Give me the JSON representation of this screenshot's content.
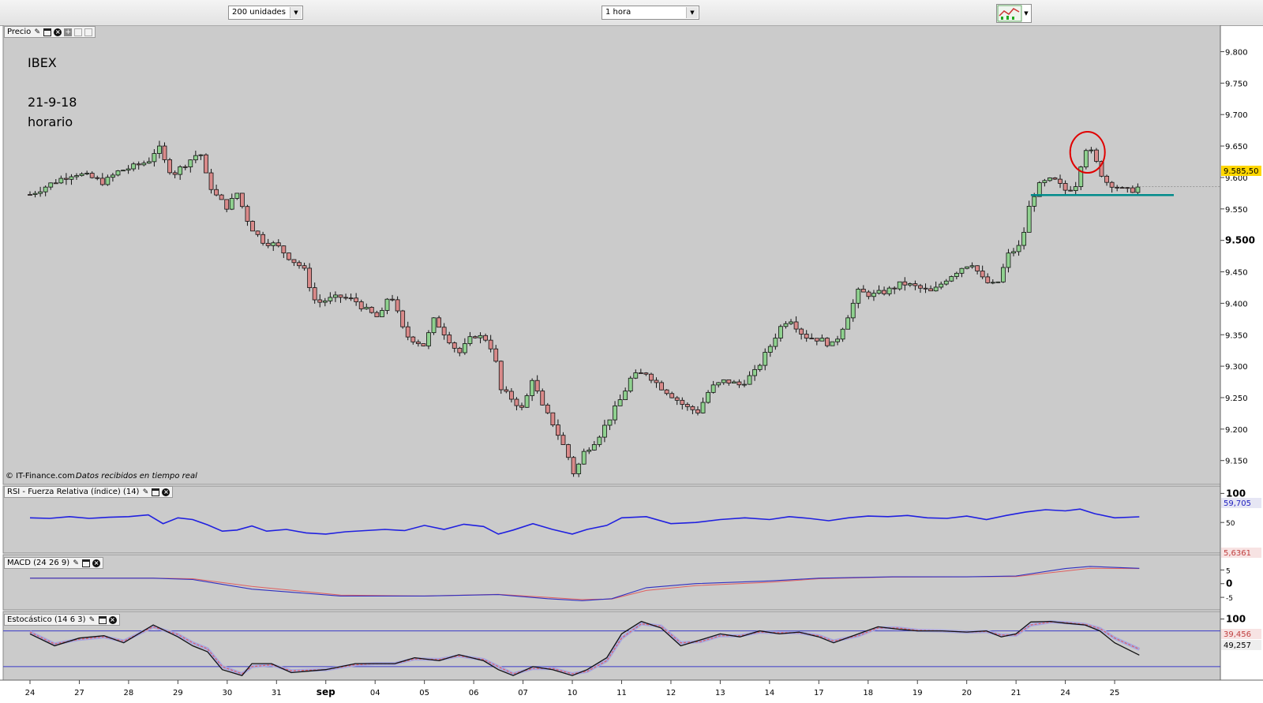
{
  "toolbar": {
    "units_select": "200 unidades",
    "interval_select": "1 hora",
    "chart_type_icon": "candlestick-chart-icon"
  },
  "panes": {
    "price_title": "Precio",
    "rsi_title": "RSI - Fuerza Relativa (índice) (14)",
    "macd_title": "MACD (24 26 9)",
    "stoch_title": "Estocástico (14 6 3)"
  },
  "annotations": {
    "symbol": "IBEX",
    "date": "21-9-18",
    "timeframe": "horario",
    "credit": "© IT-Finance.com",
    "credit_note": "Datos recibidos en tiempo real",
    "last_price": "9.585,50",
    "rsi_value": "59,705",
    "macd_value": "5,6361",
    "stoch_k_value": "49,257",
    "stoch_d_value": "39,456"
  },
  "colors": {
    "up": "#8fd18f",
    "down": "#d98a8a",
    "rsi_line": "#2020e0",
    "macd_line": "#3030c0",
    "signal_line": "#e06060",
    "support_line": "#008b8b",
    "highlight_circle": "#e00000",
    "plot_bg": "#cbcbcb"
  },
  "chart_data": {
    "type": "candlestick",
    "title": "IBEX",
    "xlabel": "",
    "ylabel": "",
    "x_tick_labels": [
      "24",
      "27",
      "28",
      "29",
      "30",
      "31",
      "sep",
      "04",
      "05",
      "06",
      "07",
      "10",
      "11",
      "12",
      "13",
      "14",
      "17",
      "18",
      "19",
      "20",
      "21",
      "24",
      "25"
    ],
    "y_tick_labels": [
      "9.800",
      "9.750",
      "9.700",
      "9.650",
      "9.600",
      "9.550",
      "9.500",
      "9.450",
      "9.400",
      "9.350",
      "9.300",
      "9.250",
      "9.200",
      "9.150"
    ],
    "ylim": [
      9112,
      9842
    ],
    "x_range": [
      0,
      23.2
    ],
    "grid": false,
    "price_path": [
      [
        0,
        9573
      ],
      [
        0.3,
        9585
      ],
      [
        0.6,
        9597
      ],
      [
        0.9,
        9607
      ],
      [
        1.2,
        9601
      ],
      [
        1.5,
        9592
      ],
      [
        1.8,
        9610
      ],
      [
        2.1,
        9617
      ],
      [
        2.4,
        9626
      ],
      [
        2.6,
        9650
      ],
      [
        2.75,
        9622
      ],
      [
        2.9,
        9605
      ],
      [
        3.2,
        9625
      ],
      [
        3.45,
        9641
      ],
      [
        3.6,
        9594
      ],
      [
        3.8,
        9568
      ],
      [
        4.0,
        9553
      ],
      [
        4.2,
        9575
      ],
      [
        4.45,
        9525
      ],
      [
        4.7,
        9500
      ],
      [
        5.0,
        9492
      ],
      [
        5.3,
        9470
      ],
      [
        5.55,
        9455
      ],
      [
        5.8,
        9400
      ],
      [
        6.0,
        9405
      ],
      [
        6.3,
        9410
      ],
      [
        6.6,
        9404
      ],
      [
        6.8,
        9390
      ],
      [
        7.1,
        9375
      ],
      [
        7.3,
        9420
      ],
      [
        7.6,
        9350
      ],
      [
        8.0,
        9333
      ],
      [
        8.2,
        9375
      ],
      [
        8.45,
        9348
      ],
      [
        8.7,
        9320
      ],
      [
        9.0,
        9350
      ],
      [
        9.3,
        9342
      ],
      [
        9.45,
        9305
      ],
      [
        9.55,
        9262
      ],
      [
        9.8,
        9247
      ],
      [
        10.0,
        9230
      ],
      [
        10.2,
        9285
      ],
      [
        10.35,
        9240
      ],
      [
        10.6,
        9210
      ],
      [
        10.9,
        9160
      ],
      [
        11.05,
        9125
      ],
      [
        11.2,
        9160
      ],
      [
        11.5,
        9185
      ],
      [
        11.7,
        9210
      ],
      [
        12.0,
        9250
      ],
      [
        12.2,
        9283
      ],
      [
        12.5,
        9290
      ],
      [
        12.75,
        9270
      ],
      [
        13.0,
        9255
      ],
      [
        13.3,
        9235
      ],
      [
        13.55,
        9228
      ],
      [
        13.8,
        9265
      ],
      [
        14.1,
        9277
      ],
      [
        14.4,
        9270
      ],
      [
        14.7,
        9290
      ],
      [
        15.0,
        9330
      ],
      [
        15.2,
        9360
      ],
      [
        15.4,
        9378
      ],
      [
        15.7,
        9348
      ],
      [
        16.0,
        9343
      ],
      [
        16.3,
        9333
      ],
      [
        16.5,
        9365
      ],
      [
        16.8,
        9418
      ],
      [
        17.1,
        9413
      ],
      [
        17.4,
        9420
      ],
      [
        17.7,
        9432
      ],
      [
        18.0,
        9425
      ],
      [
        18.3,
        9417
      ],
      [
        18.6,
        9440
      ],
      [
        18.9,
        9457
      ],
      [
        19.1,
        9465
      ],
      [
        19.35,
        9435
      ],
      [
        19.6,
        9427
      ],
      [
        19.85,
        9478
      ],
      [
        20.1,
        9492
      ],
      [
        20.3,
        9565
      ],
      [
        20.5,
        9590
      ],
      [
        20.75,
        9597
      ],
      [
        21.0,
        9580
      ],
      [
        21.2,
        9586
      ],
      [
        21.4,
        9648
      ],
      [
        21.55,
        9638
      ],
      [
        21.7,
        9610
      ],
      [
        21.85,
        9592
      ],
      [
        22.0,
        9588
      ],
      [
        22.2,
        9578
      ],
      [
        22.35,
        9580
      ],
      [
        22.5,
        9585
      ]
    ],
    "support_line": {
      "from_x": 20.3,
      "to_x": 23.2,
      "value": 9572
    },
    "highlight": {
      "x": 21.45,
      "value": 9640
    },
    "last_price": 9585.5,
    "rsi": {
      "ylim": [
        0,
        110
      ],
      "y_tick_labels": [
        "100",
        "50"
      ],
      "values": [
        [
          0,
          58
        ],
        [
          0.4,
          57
        ],
        [
          0.8,
          60
        ],
        [
          1.2,
          57
        ],
        [
          1.6,
          59
        ],
        [
          2.0,
          60
        ],
        [
          2.4,
          63
        ],
        [
          2.7,
          48
        ],
        [
          3.0,
          58
        ],
        [
          3.3,
          55
        ],
        [
          3.6,
          46
        ],
        [
          3.9,
          35
        ],
        [
          4.2,
          37
        ],
        [
          4.5,
          44
        ],
        [
          4.8,
          35
        ],
        [
          5.2,
          38
        ],
        [
          5.6,
          32
        ],
        [
          6.0,
          30
        ],
        [
          6.4,
          34
        ],
        [
          6.8,
          36
        ],
        [
          7.2,
          38
        ],
        [
          7.6,
          36
        ],
        [
          8.0,
          45
        ],
        [
          8.4,
          38
        ],
        [
          8.8,
          47
        ],
        [
          9.2,
          43
        ],
        [
          9.5,
          30
        ],
        [
          9.8,
          37
        ],
        [
          10.2,
          48
        ],
        [
          10.6,
          38
        ],
        [
          11.0,
          30
        ],
        [
          11.3,
          38
        ],
        [
          11.7,
          45
        ],
        [
          12.0,
          58
        ],
        [
          12.5,
          60
        ],
        [
          13.0,
          48
        ],
        [
          13.5,
          50
        ],
        [
          14.0,
          55
        ],
        [
          14.5,
          58
        ],
        [
          15.0,
          55
        ],
        [
          15.4,
          60
        ],
        [
          15.8,
          57
        ],
        [
          16.2,
          53
        ],
        [
          16.6,
          58
        ],
        [
          17.0,
          61
        ],
        [
          17.4,
          60
        ],
        [
          17.8,
          62
        ],
        [
          18.2,
          58
        ],
        [
          18.6,
          57
        ],
        [
          19.0,
          61
        ],
        [
          19.4,
          55
        ],
        [
          19.8,
          62
        ],
        [
          20.2,
          68
        ],
        [
          20.6,
          72
        ],
        [
          21.0,
          70
        ],
        [
          21.3,
          73
        ],
        [
          21.6,
          65
        ],
        [
          22.0,
          58
        ],
        [
          22.5,
          59.7
        ]
      ],
      "last": 59.705
    },
    "macd": {
      "ylim": [
        -9,
        10
      ],
      "y_tick_labels": [
        "5",
        "0",
        "-5"
      ],
      "macd_line": [
        [
          0,
          2
        ],
        [
          2.5,
          2
        ],
        [
          3.3,
          1.5
        ],
        [
          4.5,
          -2
        ],
        [
          6.3,
          -4.5
        ],
        [
          8.0,
          -4.5
        ],
        [
          9.5,
          -4
        ],
        [
          10.5,
          -5.5
        ],
        [
          11.2,
          -6.2
        ],
        [
          11.8,
          -5.5
        ],
        [
          12.5,
          -1.5
        ],
        [
          13.5,
          0
        ],
        [
          15.0,
          1
        ],
        [
          16.0,
          2
        ],
        [
          17.5,
          2.5
        ],
        [
          19.0,
          2.5
        ],
        [
          20.0,
          2.8
        ],
        [
          21.0,
          5.5
        ],
        [
          21.5,
          6.3
        ],
        [
          22.5,
          5.6
        ]
      ],
      "signal_line": [
        [
          0,
          2
        ],
        [
          2.5,
          2
        ],
        [
          3.3,
          1.8
        ],
        [
          4.5,
          -1
        ],
        [
          6.3,
          -4.2
        ],
        [
          8.0,
          -4.5
        ],
        [
          9.5,
          -3.9
        ],
        [
          10.5,
          -5
        ],
        [
          11.2,
          -5.8
        ],
        [
          11.8,
          -5.6
        ],
        [
          12.5,
          -2.5
        ],
        [
          13.5,
          -0.7
        ],
        [
          15.0,
          0.5
        ],
        [
          16.0,
          1.8
        ],
        [
          17.5,
          2.4
        ],
        [
          19.0,
          2.5
        ],
        [
          20.0,
          2.6
        ],
        [
          21.0,
          4.6
        ],
        [
          21.5,
          5.6
        ],
        [
          22.5,
          5.5
        ]
      ],
      "last": 5.6361
    },
    "stochastic": {
      "ylim": [
        0,
        110
      ],
      "y_tick_labels": [
        "100"
      ],
      "levels": [
        80,
        20
      ],
      "k_line": [
        [
          0,
          75
        ],
        [
          0.5,
          55
        ],
        [
          1.0,
          68
        ],
        [
          1.5,
          72
        ],
        [
          1.9,
          60
        ],
        [
          2.5,
          90
        ],
        [
          3.0,
          70
        ],
        [
          3.3,
          55
        ],
        [
          3.6,
          45
        ],
        [
          3.9,
          15
        ],
        [
          4.3,
          5
        ],
        [
          4.5,
          25
        ],
        [
          4.9,
          25
        ],
        [
          5.3,
          10
        ],
        [
          6.0,
          15
        ],
        [
          6.6,
          25
        ],
        [
          7.0,
          25
        ],
        [
          7.4,
          25
        ],
        [
          7.8,
          35
        ],
        [
          8.3,
          30
        ],
        [
          8.7,
          40
        ],
        [
          9.2,
          30
        ],
        [
          9.5,
          15
        ],
        [
          9.8,
          5
        ],
        [
          10.2,
          20
        ],
        [
          10.6,
          15
        ],
        [
          11.0,
          5
        ],
        [
          11.3,
          15
        ],
        [
          11.7,
          35
        ],
        [
          12.0,
          75
        ],
        [
          12.4,
          96
        ],
        [
          12.8,
          85
        ],
        [
          13.2,
          55
        ],
        [
          13.6,
          65
        ],
        [
          14.0,
          75
        ],
        [
          14.4,
          70
        ],
        [
          14.8,
          80
        ],
        [
          15.2,
          75
        ],
        [
          15.6,
          78
        ],
        [
          16.0,
          70
        ],
        [
          16.3,
          60
        ],
        [
          16.8,
          75
        ],
        [
          17.2,
          87
        ],
        [
          17.6,
          83
        ],
        [
          18.0,
          80
        ],
        [
          18.5,
          80
        ],
        [
          19.0,
          78
        ],
        [
          19.4,
          80
        ],
        [
          19.7,
          70
        ],
        [
          20.0,
          75
        ],
        [
          20.3,
          95
        ],
        [
          20.7,
          96
        ],
        [
          21.0,
          93
        ],
        [
          21.4,
          90
        ],
        [
          21.7,
          80
        ],
        [
          22.0,
          60
        ],
        [
          22.5,
          39.4
        ]
      ],
      "d_line": [
        [
          0,
          78
        ],
        [
          0.5,
          58
        ],
        [
          1.0,
          66
        ],
        [
          1.5,
          70
        ],
        [
          1.9,
          63
        ],
        [
          2.5,
          87
        ],
        [
          3.0,
          74
        ],
        [
          3.3,
          60
        ],
        [
          3.6,
          50
        ],
        [
          3.9,
          20
        ],
        [
          4.3,
          8
        ],
        [
          4.5,
          20
        ],
        [
          4.9,
          23
        ],
        [
          5.3,
          13
        ],
        [
          6.0,
          15
        ],
        [
          6.6,
          23
        ],
        [
          7.0,
          25
        ],
        [
          7.4,
          25
        ],
        [
          7.8,
          33
        ],
        [
          8.3,
          32
        ],
        [
          8.7,
          38
        ],
        [
          9.2,
          32
        ],
        [
          9.5,
          20
        ],
        [
          9.8,
          8
        ],
        [
          10.2,
          17
        ],
        [
          10.6,
          17
        ],
        [
          11.0,
          8
        ],
        [
          11.3,
          12
        ],
        [
          11.7,
          30
        ],
        [
          12.0,
          68
        ],
        [
          12.4,
          92
        ],
        [
          12.8,
          88
        ],
        [
          13.2,
          60
        ],
        [
          13.6,
          62
        ],
        [
          14.0,
          72
        ],
        [
          14.4,
          72
        ],
        [
          14.8,
          78
        ],
        [
          15.2,
          77
        ],
        [
          15.6,
          77
        ],
        [
          16.0,
          72
        ],
        [
          16.3,
          63
        ],
        [
          16.8,
          72
        ],
        [
          17.2,
          85
        ],
        [
          17.6,
          85
        ],
        [
          18.0,
          81
        ],
        [
          18.5,
          80
        ],
        [
          19.0,
          78
        ],
        [
          19.4,
          79
        ],
        [
          19.7,
          73
        ],
        [
          20.0,
          73
        ],
        [
          20.3,
          90
        ],
        [
          20.7,
          95
        ],
        [
          21.0,
          94
        ],
        [
          21.4,
          91
        ],
        [
          21.7,
          84
        ],
        [
          22.0,
          68
        ],
        [
          22.5,
          49.3
        ]
      ],
      "last_k": 39.456,
      "last_d": 49.257
    }
  }
}
